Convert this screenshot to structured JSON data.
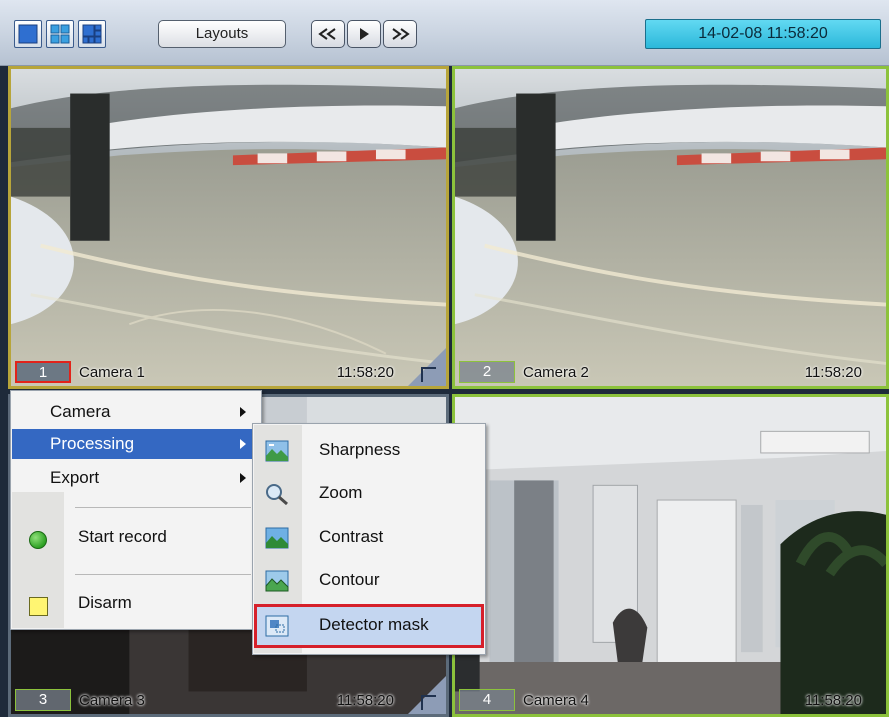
{
  "toolbar": {
    "layout_buttons": [
      {
        "icon": "single-view-icon"
      },
      {
        "icon": "grid-2x2-icon"
      },
      {
        "icon": "grid-mixed-icon"
      }
    ],
    "layouts_label": "Layouts",
    "nav_buttons": [
      {
        "icon": "rewind-icon"
      },
      {
        "icon": "play-icon"
      },
      {
        "icon": "fast-forward-icon"
      }
    ],
    "datetime": "14-02-08   11:58:20"
  },
  "cameras": [
    {
      "number": "1",
      "name": "Camera 1",
      "time": "11:58:20",
      "selected": true
    },
    {
      "number": "2",
      "name": "Camera 2",
      "time": "11:58:20",
      "selected": false
    },
    {
      "number": "3",
      "name": "Camera 3",
      "time": "11:58:20",
      "selected": false
    },
    {
      "number": "4",
      "name": "Camera 4",
      "time": "11:58:20",
      "selected": false
    }
  ],
  "context_menu": {
    "items": [
      {
        "label": "Camera",
        "has_submenu": true
      },
      {
        "label": "Processing",
        "has_submenu": true,
        "active": true
      },
      {
        "label": "Export",
        "has_submenu": true
      },
      {
        "label": "Start record",
        "icon": "green-circle-icon"
      },
      {
        "label": "Disarm",
        "icon": "yellow-square-icon"
      }
    ]
  },
  "processing_submenu": {
    "items": [
      {
        "label": "Sharpness",
        "icon": "sharpness-icon"
      },
      {
        "label": "Zoom",
        "icon": "zoom-icon"
      },
      {
        "label": "Contrast",
        "icon": "contrast-icon"
      },
      {
        "label": "Contour",
        "icon": "contour-icon"
      },
      {
        "label": "Detector mask",
        "icon": "detector-mask-icon",
        "highlighted": true
      }
    ]
  },
  "colors": {
    "menu_active": "#3468c2",
    "highlight_border": "#d6202a",
    "selected_frame": "#b7a53a",
    "camera_frame": "#8cc23c",
    "datetime_bg": "#2bb8da"
  }
}
